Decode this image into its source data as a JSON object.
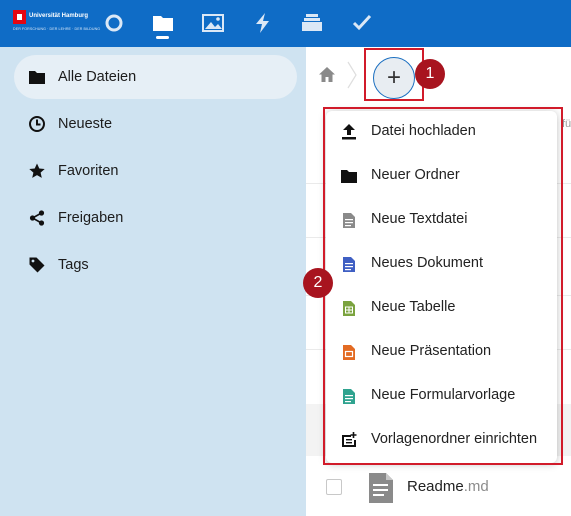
{
  "brand": {
    "name": "Universität Hamburg",
    "tagline": "DER FORSCHUNG · DER LEHRE · DER BILDUNG"
  },
  "topnav": {
    "items": [
      "dashboard-icon",
      "files-icon",
      "photos-icon",
      "activity-icon",
      "deck-icon",
      "tasks-icon"
    ],
    "active": "files-icon"
  },
  "sidebar": {
    "items": [
      {
        "label": "Alle Dateien",
        "icon": "folder-icon",
        "active": true
      },
      {
        "label": "Neueste",
        "icon": "clock-icon"
      },
      {
        "label": "Favoriten",
        "icon": "star-icon"
      },
      {
        "label": "Freigaben",
        "icon": "share-icon"
      },
      {
        "label": "Tags",
        "icon": "tag-icon"
      }
    ]
  },
  "toolbar": {
    "add_label": "+"
  },
  "annotations": {
    "badge1": "1",
    "badge2": "2",
    "highlight_color": "#d11b2a"
  },
  "new_menu": {
    "items": [
      {
        "label": "Datei hochladen",
        "icon": "upload-icon"
      },
      {
        "label": "Neuer Ordner",
        "icon": "folder-icon"
      },
      {
        "label": "Neue Textdatei",
        "icon": "text-file-icon"
      },
      {
        "label": "Neues Dokument",
        "icon": "document-icon"
      },
      {
        "label": "Neue Tabelle",
        "icon": "spreadsheet-icon"
      },
      {
        "label": "Neue Präsentation",
        "icon": "presentation-icon"
      },
      {
        "label": "Neue Formularvorlage",
        "icon": "form-template-icon"
      },
      {
        "label": "Vorlagenordner einrichten",
        "icon": "template-folder-icon"
      }
    ]
  },
  "files": {
    "partial_text": "fü",
    "rows": [
      {
        "name": "Readme",
        "ext": ".md"
      }
    ]
  },
  "colors": {
    "topbar": "#0f6cc6",
    "sidebar": "#cfe3f1",
    "badge": "#a8141f"
  }
}
